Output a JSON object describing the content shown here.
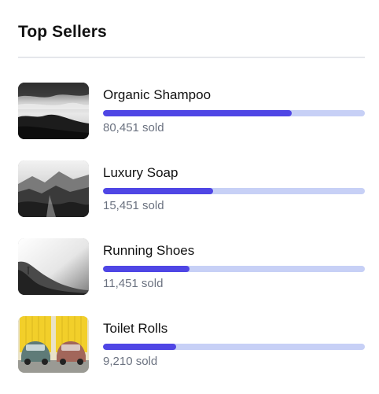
{
  "header": {
    "title": "Top Sellers"
  },
  "colors": {
    "bar_fill": "#4f46e5",
    "bar_track": "#c7d0f6",
    "divider": "#e5e7eb",
    "muted_text": "#6b7280"
  },
  "products": [
    {
      "name": "Organic Shampoo",
      "sold_text": "80,451 sold",
      "progress": 0.72,
      "thumbnail": "misty-landscape-bw"
    },
    {
      "name": "Luxury Soap",
      "sold_text": "15,451 sold",
      "progress": 0.42,
      "thumbnail": "mountain-valley-bw"
    },
    {
      "name": "Running Shoes",
      "sold_text": "11,451 sold",
      "progress": 0.33,
      "thumbnail": "foggy-shore-bw"
    },
    {
      "name": "Toilet Rolls",
      "sold_text": "9,210 sold",
      "progress": 0.28,
      "thumbnail": "vintage-cars-yellow-doors"
    }
  ]
}
